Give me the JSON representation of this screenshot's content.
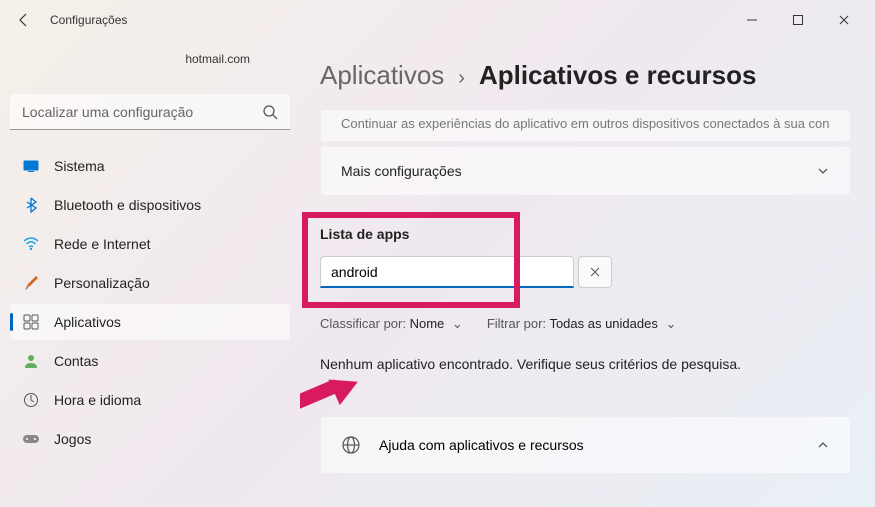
{
  "window": {
    "title": "Configurações"
  },
  "account": {
    "email": "hotmail.com"
  },
  "search": {
    "placeholder": "Localizar uma configuração"
  },
  "sidebar": {
    "items": [
      {
        "label": "Sistema"
      },
      {
        "label": "Bluetooth e dispositivos"
      },
      {
        "label": "Rede e Internet"
      },
      {
        "label": "Personalização"
      },
      {
        "label": "Aplicativos"
      },
      {
        "label": "Contas"
      },
      {
        "label": "Hora e idioma"
      },
      {
        "label": "Jogos"
      }
    ]
  },
  "breadcrumb": {
    "parent": "Aplicativos",
    "sep": "›",
    "current": "Aplicativos e recursos"
  },
  "cards": {
    "partial": "Continuar as experiências do aplicativo em outros dispositivos conectados à sua conta",
    "more": "Mais configurações"
  },
  "appList": {
    "title": "Lista de apps",
    "searchValue": "android",
    "sortLabel": "Classificar por:",
    "sortValue": "Nome",
    "filterLabel": "Filtrar por:",
    "filterValue": "Todas as unidades",
    "noResults": "Nenhum aplicativo encontrado. Verifique seus critérios de pesquisa."
  },
  "help": {
    "title": "Ajuda com aplicativos e recursos"
  }
}
